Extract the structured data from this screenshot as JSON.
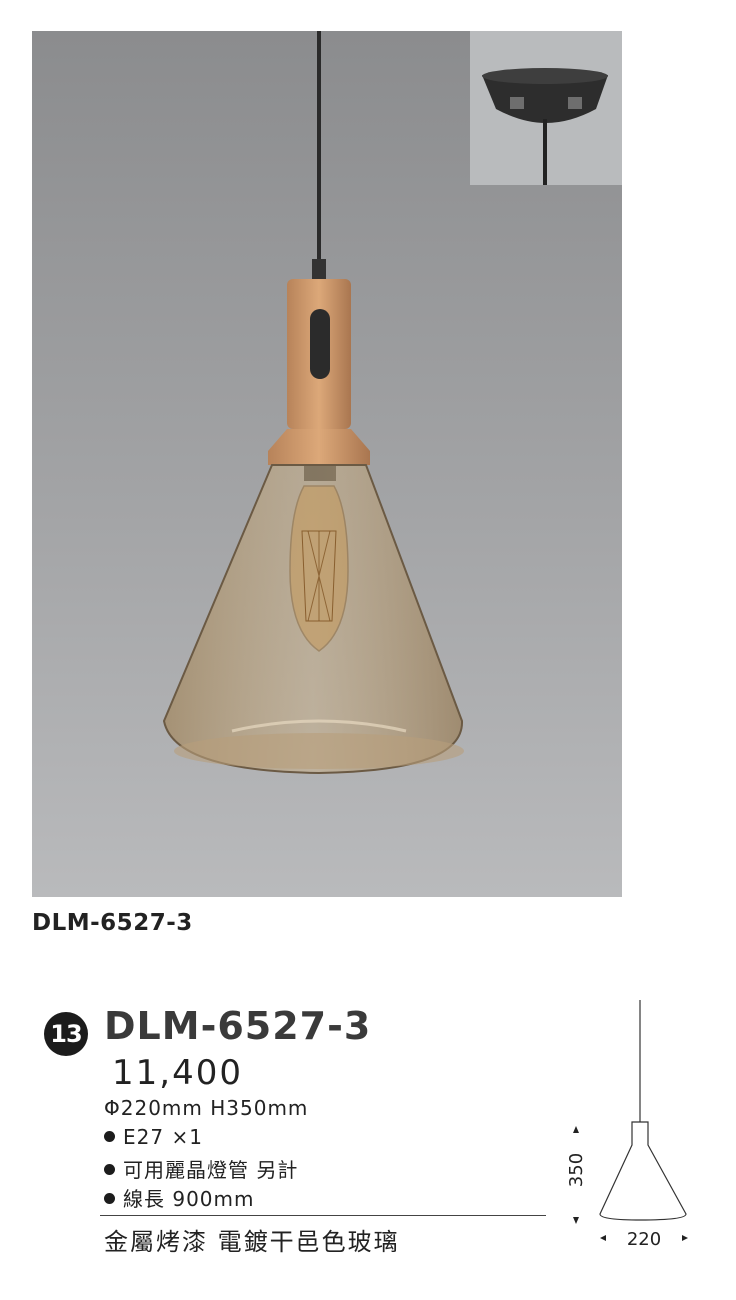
{
  "caption": "DLM-6527-3",
  "product": {
    "index": "13",
    "model": "DLM-6527-3",
    "price": "11,400",
    "dimensions": "Φ220mm H350mm",
    "specs": [
      "E27 ×1",
      "可用麗晶燈管 另計",
      "線長 900mm"
    ],
    "material": "金屬烤漆 電鍍干邑色玻璃"
  },
  "diagram": {
    "height_label": "350",
    "width_label": "220"
  }
}
